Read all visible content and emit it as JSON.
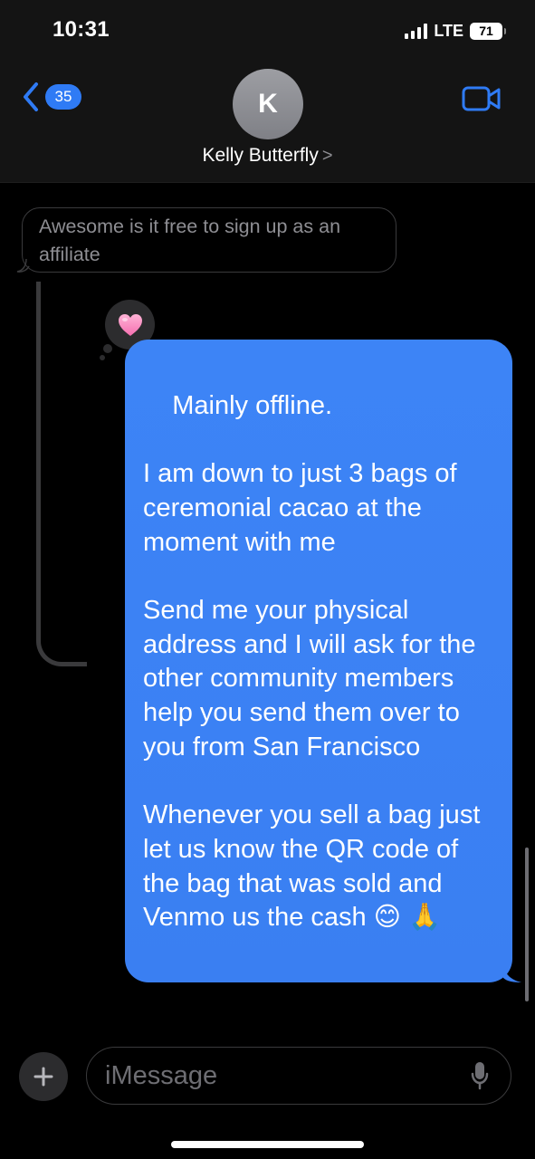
{
  "status_bar": {
    "time": "10:31",
    "network": "LTE",
    "battery": "71"
  },
  "header": {
    "back_count": "35",
    "avatar_initial": "K",
    "contact_name": "Kelly Butterfly",
    "contact_chevron": ">",
    "video_icon": "video-camera-icon"
  },
  "thread": {
    "quoted_message": "Awesome is it free to sign up as an affiliate",
    "tapback_icon": "pink-heart-icon",
    "reply_message": "Mainly offline.\n\nI am down to just 3 bags of ceremonial cacao at the moment with me\n\nSend me your physical address and I will ask for the other community members help you send them over to you from San Francisco\n\nWhenever you sell a bag just let us know the QR code of the bag that was sold and Venmo us the cash 😊 🙏"
  },
  "input_bar": {
    "placeholder": "iMessage",
    "plus_icon": "plus-icon",
    "mic_icon": "microphone-icon"
  },
  "colors": {
    "bubble_blue": "#3d84f6",
    "accent_blue": "#2f7bf5",
    "background": "#000000",
    "header_bg": "#141414"
  }
}
